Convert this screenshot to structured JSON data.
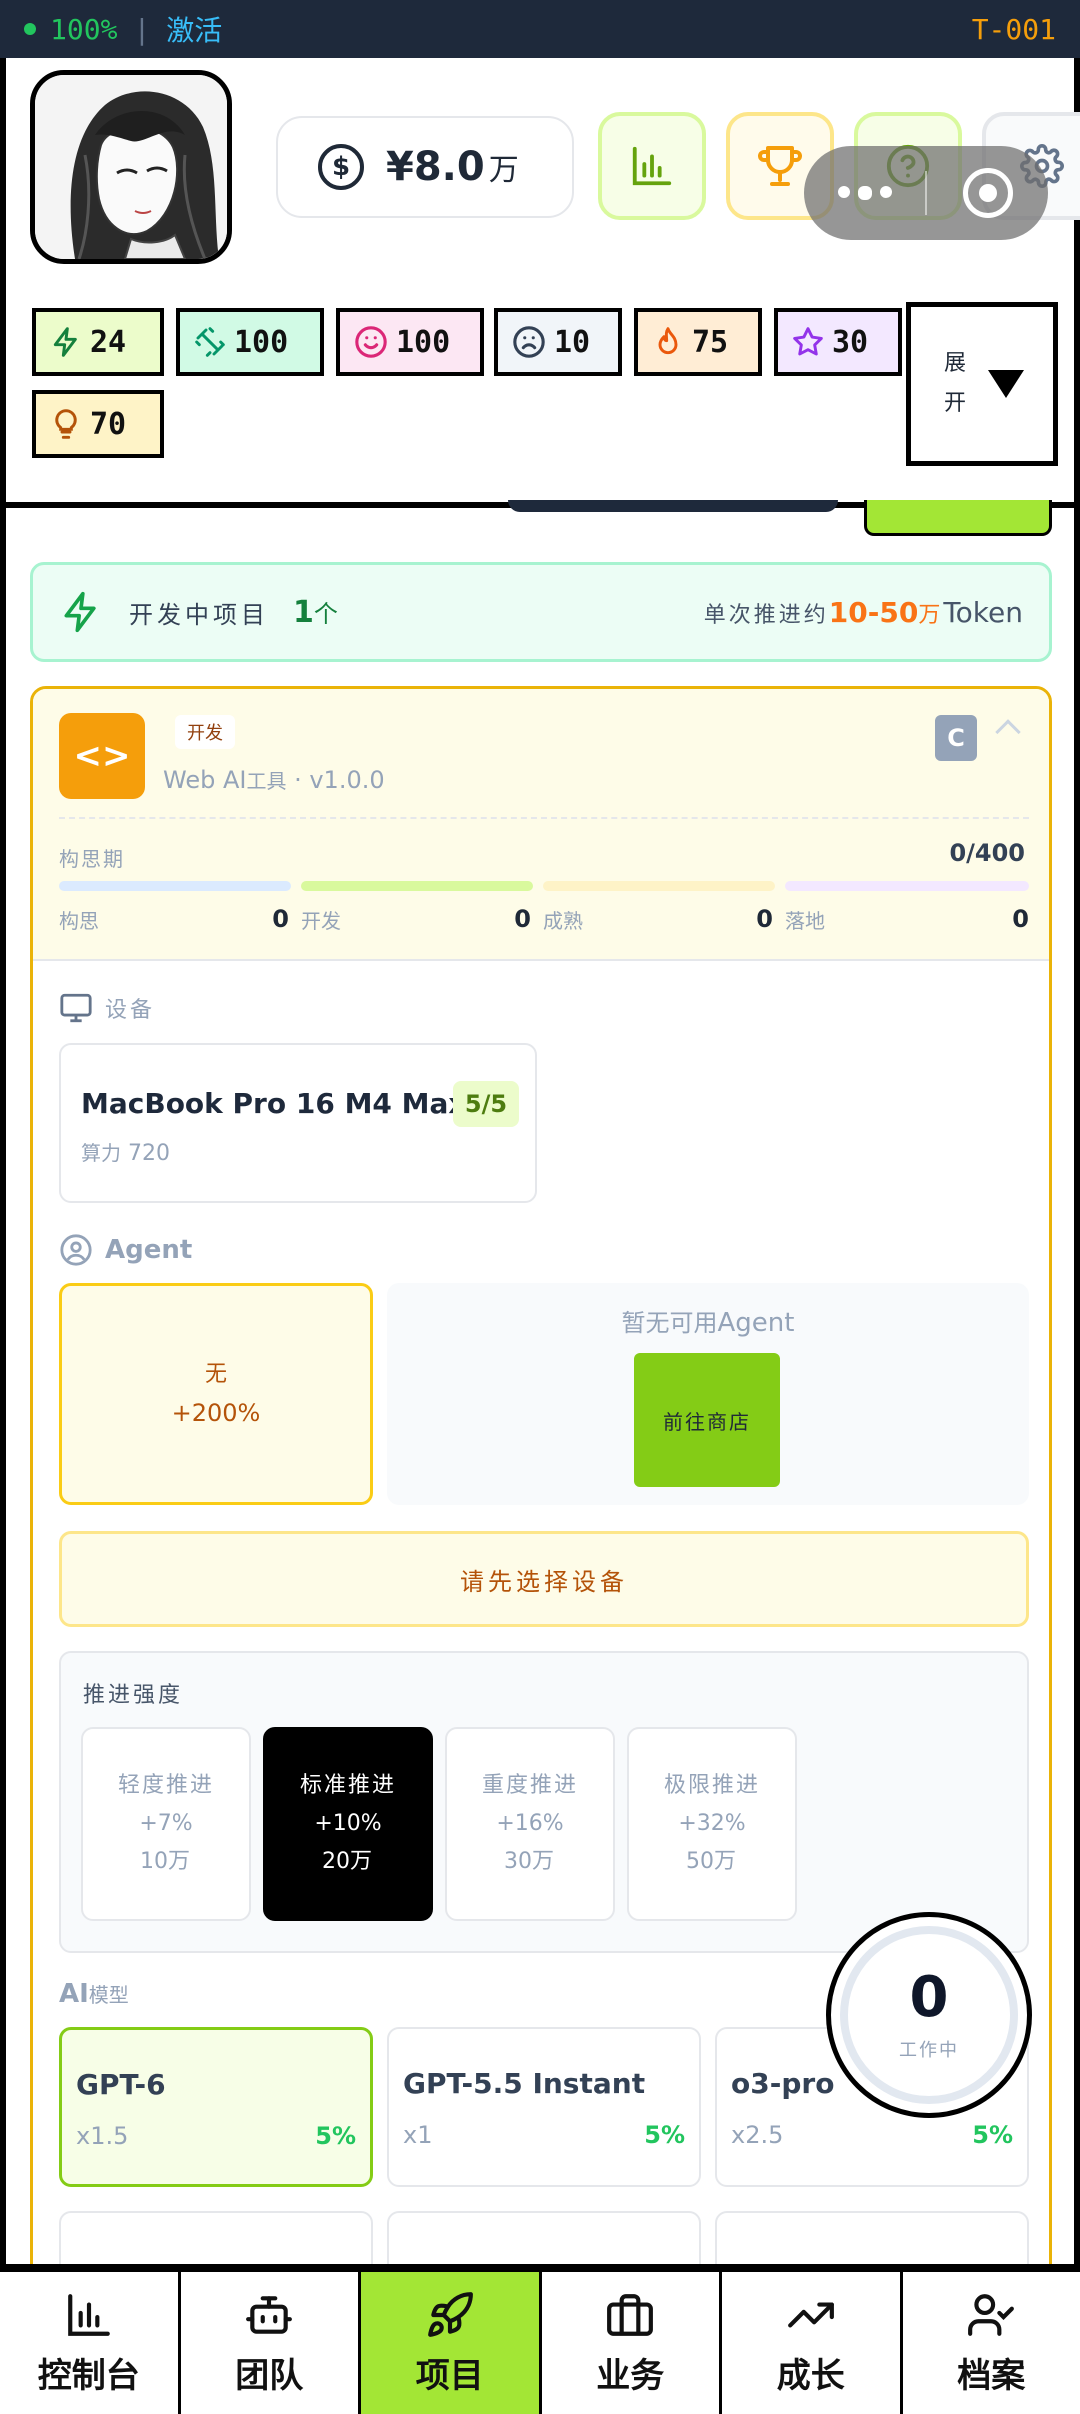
{
  "status_bar": {
    "battery": "100%",
    "separator": "|",
    "activate": "激活",
    "terminal_id": "T-001"
  },
  "header": {
    "money": {
      "currency_icon": "dollar-icon",
      "amount": "¥8.0",
      "unit": "万"
    },
    "buttons": [
      {
        "name": "stats",
        "icon": "bar-chart-icon",
        "color": "#65a30d"
      },
      {
        "name": "trophy",
        "icon": "trophy-icon",
        "color": "#f59e0b"
      },
      {
        "name": "help",
        "icon": "help-icon",
        "color": "#65a30d"
      },
      {
        "name": "settings",
        "icon": "gear-icon",
        "color": "#64748b"
      }
    ],
    "stats": [
      {
        "icon": "lightning-icon",
        "value": "24",
        "bg": "#ecfccb"
      },
      {
        "icon": "dumbbell-icon",
        "value": "100",
        "bg": "#d1fae5"
      },
      {
        "icon": "smile-icon",
        "value": "100",
        "bg": "#fce7f3"
      },
      {
        "icon": "frown-icon",
        "value": "10",
        "bg": "#f1f5f9"
      },
      {
        "icon": "flame-icon",
        "value": "75",
        "bg": "#ffedd5"
      },
      {
        "icon": "star-icon",
        "value": "30",
        "bg": "#f3e8ff"
      },
      {
        "icon": "bulb-icon",
        "value": "70",
        "bg": "#fef3c7"
      }
    ],
    "expand_label": "展开"
  },
  "dev_bar": {
    "label": "开发中项目",
    "count": "1",
    "count_unit": "个",
    "push_prefix": "单次推进约",
    "push_range": "10-50",
    "push_unit": "万",
    "push_suffix": "Token"
  },
  "project": {
    "type_tag": "开发",
    "subtitle_prefix": "Web AI",
    "subtitle_tool": "工具",
    "subtitle_version": "· v1.0.0",
    "grade": "C",
    "phase_label": "构思期",
    "phase_progress": "0/400",
    "phases": [
      {
        "name": "构思",
        "value": "0",
        "color": "#dbeafe"
      },
      {
        "name": "开发",
        "value": "0",
        "color": "#d9f99d"
      },
      {
        "name": "成熟",
        "value": "0",
        "color": "#fef3c7"
      },
      {
        "name": "落地",
        "value": "0",
        "color": "#f3e8ff"
      }
    ],
    "device_section": "设备",
    "device": {
      "name": "MacBook Pro 16 M4 Max",
      "capacity": "5/5",
      "power_label": "算力",
      "power_value": "720"
    },
    "agent_section": "Agent",
    "agent_none_label": "无",
    "agent_none_bonus": "+200%",
    "agent_empty_prefix": "暂无可用",
    "agent_empty_suffix": "Agent",
    "shop_button": "前往商店",
    "warning": "请先选择设备",
    "intensity_title": "推进强度",
    "intensity_options": [
      {
        "name": "轻度推进",
        "bonus": "+7%",
        "cost": "10",
        "unit": "万",
        "selected": false
      },
      {
        "name": "标准推进",
        "bonus": "+10%",
        "cost": "20",
        "unit": "万",
        "selected": true
      },
      {
        "name": "重度推进",
        "bonus": "+16%",
        "cost": "30",
        "unit": "万",
        "selected": false
      },
      {
        "name": "极限推进",
        "bonus": "+32%",
        "cost": "50",
        "unit": "万",
        "selected": false
      }
    ],
    "model_title_prefix": "AI",
    "model_title_suffix": "模型",
    "models": [
      {
        "name": "GPT-6",
        "multiplier": "x1.5",
        "percent": "5%",
        "selected": true
      },
      {
        "name": "GPT-5.5 Instant",
        "multiplier": "x1",
        "percent": "5%",
        "selected": false
      },
      {
        "name": "o3-pro",
        "multiplier": "x2.5",
        "percent": "5%",
        "selected": false
      }
    ]
  },
  "worker": {
    "count": "0",
    "label": "工作中"
  },
  "nav": [
    {
      "label": "控制台",
      "icon": "bar-chart-icon",
      "active": false
    },
    {
      "label": "团队",
      "icon": "robot-icon",
      "active": false
    },
    {
      "label": "项目",
      "icon": "rocket-icon",
      "active": true
    },
    {
      "label": "业务",
      "icon": "briefcase-icon",
      "active": false
    },
    {
      "label": "成长",
      "icon": "trending-up-icon",
      "active": false
    },
    {
      "label": "档案",
      "icon": "user-check-icon",
      "active": false
    }
  ]
}
